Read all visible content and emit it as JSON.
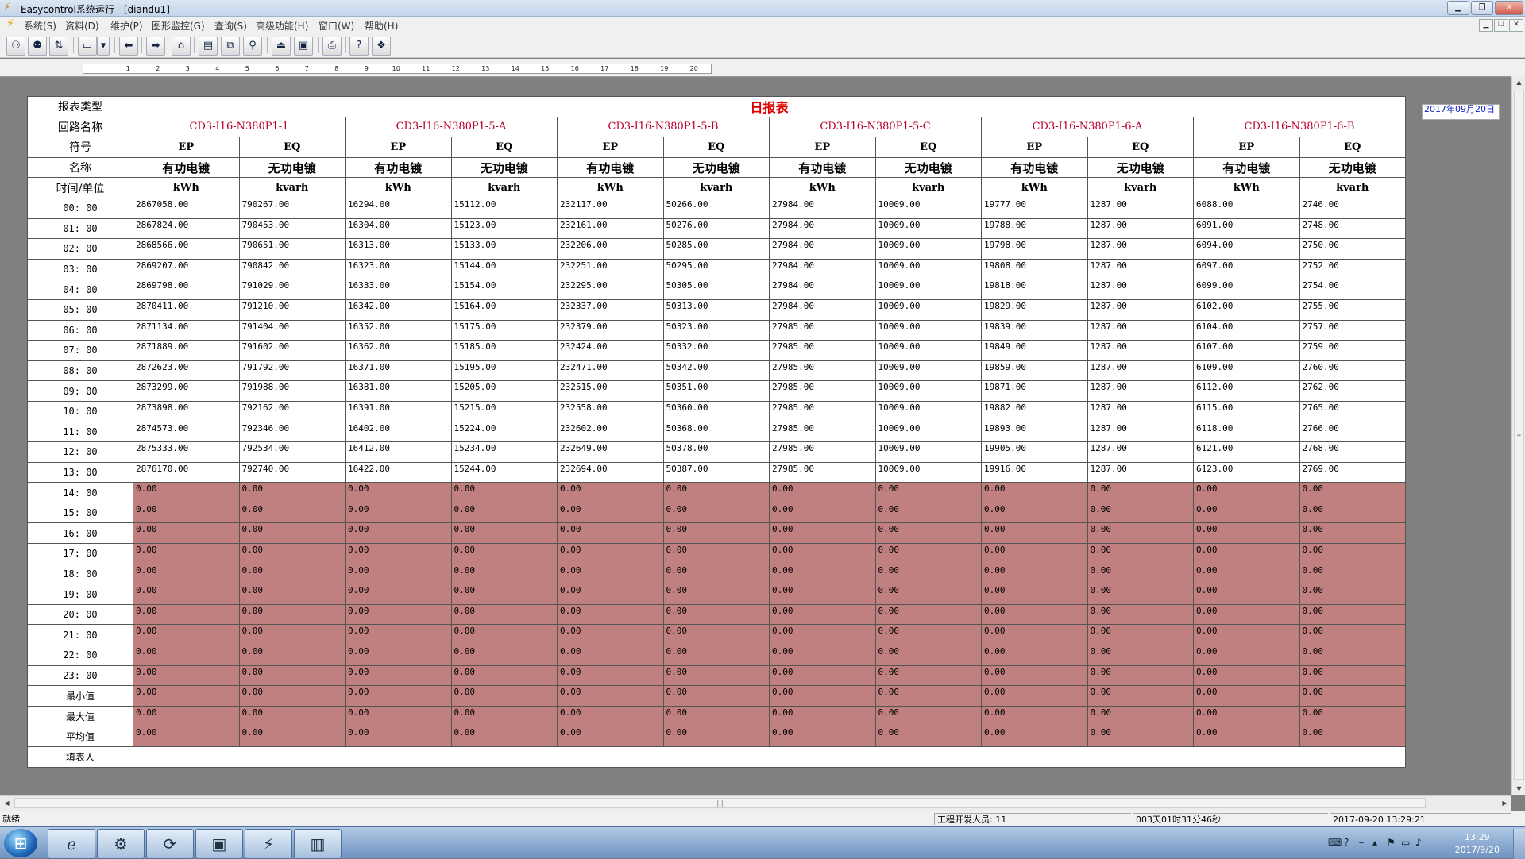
{
  "window": {
    "title": "Easycontrol系统运行 - [diandu1]",
    "minimize_icon": "minimize-icon",
    "restore_icon": "restore-icon",
    "close_icon": "close-icon"
  },
  "menu": [
    "系统(S)",
    "资料(D)",
    "维护(P)",
    "图形监控(G)",
    "查询(S)",
    "高级功能(H)",
    "窗口(W)",
    "帮助(H)"
  ],
  "ruler": {
    "labels": [
      " ",
      "1",
      "2",
      "3",
      "4",
      "5",
      "6",
      "7",
      "8",
      "9",
      "10",
      "11",
      "12",
      "13",
      "14",
      "15",
      "16",
      "17",
      "18",
      "19",
      "20"
    ]
  },
  "report": {
    "type_label": "报表类型",
    "title": "日报表",
    "circuit_label": "回路名称",
    "symbol_label": "符号",
    "name_label": "名称",
    "time_unit_label": "时间/单位",
    "filler_label": "填表人",
    "circuits": [
      "CD3-I16-N380P1-1",
      "CD3-I16-N380P1-5-A",
      "CD3-I16-N380P1-5-B",
      "CD3-I16-N380P1-5-C",
      "CD3-I16-N380P1-6-A",
      "CD3-I16-N380P1-6-B"
    ],
    "symbols": [
      "EP",
      "EQ",
      "EP",
      "EQ",
      "EP",
      "EQ",
      "EP",
      "EQ",
      "EP",
      "EQ",
      "EP",
      "EQ"
    ],
    "names": [
      "有功电镀",
      "无功电镀",
      "有功电镀",
      "无功电镀",
      "有功电镀",
      "无功电镀",
      "有功电镀",
      "无功电镀",
      "有功电镀",
      "无功电镀",
      "有功电镀",
      "无功电镀"
    ],
    "units": [
      "kWh",
      "kvarh",
      "kWh",
      "kvarh",
      "kWh",
      "kvarh",
      "kWh",
      "kvarh",
      "kWh",
      "kvarh",
      "kWh",
      "kvarh"
    ],
    "date": "2017年09月20日",
    "rows": [
      {
        "time": "00: 00",
        "values": [
          "2867058.00",
          "790267.00",
          "16294.00",
          "15112.00",
          "232117.00",
          "50266.00",
          "27984.00",
          "10009.00",
          "19777.00",
          "1287.00",
          "6088.00",
          "2746.00"
        ]
      },
      {
        "time": "01: 00",
        "values": [
          "2867824.00",
          "790453.00",
          "16304.00",
          "15123.00",
          "232161.00",
          "50276.00",
          "27984.00",
          "10009.00",
          "19788.00",
          "1287.00",
          "6091.00",
          "2748.00"
        ]
      },
      {
        "time": "02: 00",
        "values": [
          "2868566.00",
          "790651.00",
          "16313.00",
          "15133.00",
          "232206.00",
          "50285.00",
          "27984.00",
          "10009.00",
          "19798.00",
          "1287.00",
          "6094.00",
          "2750.00"
        ]
      },
      {
        "time": "03: 00",
        "values": [
          "2869207.00",
          "790842.00",
          "16323.00",
          "15144.00",
          "232251.00",
          "50295.00",
          "27984.00",
          "10009.00",
          "19808.00",
          "1287.00",
          "6097.00",
          "2752.00"
        ]
      },
      {
        "time": "04: 00",
        "values": [
          "2869798.00",
          "791029.00",
          "16333.00",
          "15154.00",
          "232295.00",
          "50305.00",
          "27984.00",
          "10009.00",
          "19818.00",
          "1287.00",
          "6099.00",
          "2754.00"
        ]
      },
      {
        "time": "05: 00",
        "values": [
          "2870411.00",
          "791210.00",
          "16342.00",
          "15164.00",
          "232337.00",
          "50313.00",
          "27984.00",
          "10009.00",
          "19829.00",
          "1287.00",
          "6102.00",
          "2755.00"
        ]
      },
      {
        "time": "06: 00",
        "values": [
          "2871134.00",
          "791404.00",
          "16352.00",
          "15175.00",
          "232379.00",
          "50323.00",
          "27985.00",
          "10009.00",
          "19839.00",
          "1287.00",
          "6104.00",
          "2757.00"
        ]
      },
      {
        "time": "07: 00",
        "values": [
          "2871889.00",
          "791602.00",
          "16362.00",
          "15185.00",
          "232424.00",
          "50332.00",
          "27985.00",
          "10009.00",
          "19849.00",
          "1287.00",
          "6107.00",
          "2759.00"
        ]
      },
      {
        "time": "08: 00",
        "values": [
          "2872623.00",
          "791792.00",
          "16371.00",
          "15195.00",
          "232471.00",
          "50342.00",
          "27985.00",
          "10009.00",
          "19859.00",
          "1287.00",
          "6109.00",
          "2760.00"
        ]
      },
      {
        "time": "09: 00",
        "values": [
          "2873299.00",
          "791988.00",
          "16381.00",
          "15205.00",
          "232515.00",
          "50351.00",
          "27985.00",
          "10009.00",
          "19871.00",
          "1287.00",
          "6112.00",
          "2762.00"
        ]
      },
      {
        "time": "10: 00",
        "values": [
          "2873898.00",
          "792162.00",
          "16391.00",
          "15215.00",
          "232558.00",
          "50360.00",
          "27985.00",
          "10009.00",
          "19882.00",
          "1287.00",
          "6115.00",
          "2765.00"
        ]
      },
      {
        "time": "11: 00",
        "values": [
          "2874573.00",
          "792346.00",
          "16402.00",
          "15224.00",
          "232602.00",
          "50368.00",
          "27985.00",
          "10009.00",
          "19893.00",
          "1287.00",
          "6118.00",
          "2766.00"
        ]
      },
      {
        "time": "12: 00",
        "values": [
          "2875333.00",
          "792534.00",
          "16412.00",
          "15234.00",
          "232649.00",
          "50378.00",
          "27985.00",
          "10009.00",
          "19905.00",
          "1287.00",
          "6121.00",
          "2768.00"
        ]
      },
      {
        "time": "13: 00",
        "values": [
          "2876170.00",
          "792740.00",
          "16422.00",
          "15244.00",
          "232694.00",
          "50387.00",
          "27985.00",
          "10009.00",
          "19916.00",
          "1287.00",
          "6123.00",
          "2769.00"
        ]
      },
      {
        "time": "14: 00",
        "values": [
          "0.00",
          "0.00",
          "0.00",
          "0.00",
          "0.00",
          "0.00",
          "0.00",
          "0.00",
          "0.00",
          "0.00",
          "0.00",
          "0.00"
        ],
        "empty": true
      },
      {
        "time": "15: 00",
        "values": [
          "0.00",
          "0.00",
          "0.00",
          "0.00",
          "0.00",
          "0.00",
          "0.00",
          "0.00",
          "0.00",
          "0.00",
          "0.00",
          "0.00"
        ],
        "empty": true
      },
      {
        "time": "16: 00",
        "values": [
          "0.00",
          "0.00",
          "0.00",
          "0.00",
          "0.00",
          "0.00",
          "0.00",
          "0.00",
          "0.00",
          "0.00",
          "0.00",
          "0.00"
        ],
        "empty": true
      },
      {
        "time": "17: 00",
        "values": [
          "0.00",
          "0.00",
          "0.00",
          "0.00",
          "0.00",
          "0.00",
          "0.00",
          "0.00",
          "0.00",
          "0.00",
          "0.00",
          "0.00"
        ],
        "empty": true
      },
      {
        "time": "18: 00",
        "values": [
          "0.00",
          "0.00",
          "0.00",
          "0.00",
          "0.00",
          "0.00",
          "0.00",
          "0.00",
          "0.00",
          "0.00",
          "0.00",
          "0.00"
        ],
        "empty": true
      },
      {
        "time": "19: 00",
        "values": [
          "0.00",
          "0.00",
          "0.00",
          "0.00",
          "0.00",
          "0.00",
          "0.00",
          "0.00",
          "0.00",
          "0.00",
          "0.00",
          "0.00"
        ],
        "empty": true
      },
      {
        "time": "20: 00",
        "values": [
          "0.00",
          "0.00",
          "0.00",
          "0.00",
          "0.00",
          "0.00",
          "0.00",
          "0.00",
          "0.00",
          "0.00",
          "0.00",
          "0.00"
        ],
        "empty": true
      },
      {
        "time": "21: 00",
        "values": [
          "0.00",
          "0.00",
          "0.00",
          "0.00",
          "0.00",
          "0.00",
          "0.00",
          "0.00",
          "0.00",
          "0.00",
          "0.00",
          "0.00"
        ],
        "empty": true
      },
      {
        "time": "22: 00",
        "values": [
          "0.00",
          "0.00",
          "0.00",
          "0.00",
          "0.00",
          "0.00",
          "0.00",
          "0.00",
          "0.00",
          "0.00",
          "0.00",
          "0.00"
        ],
        "empty": true
      },
      {
        "time": "23: 00",
        "values": [
          "0.00",
          "0.00",
          "0.00",
          "0.00",
          "0.00",
          "0.00",
          "0.00",
          "0.00",
          "0.00",
          "0.00",
          "0.00",
          "0.00"
        ],
        "empty": true
      }
    ],
    "stats": [
      {
        "label": "最小值",
        "values": [
          "0.00",
          "0.00",
          "0.00",
          "0.00",
          "0.00",
          "0.00",
          "0.00",
          "0.00",
          "0.00",
          "0.00",
          "0.00",
          "0.00"
        ]
      },
      {
        "label": "最大值",
        "values": [
          "0.00",
          "0.00",
          "0.00",
          "0.00",
          "0.00",
          "0.00",
          "0.00",
          "0.00",
          "0.00",
          "0.00",
          "0.00",
          "0.00"
        ]
      },
      {
        "label": "平均值",
        "values": [
          "0.00",
          "0.00",
          "0.00",
          "0.00",
          "0.00",
          "0.00",
          "0.00",
          "0.00",
          "0.00",
          "0.00",
          "0.00",
          "0.00"
        ]
      }
    ],
    "empty_cell_color": "#c08080"
  },
  "status": {
    "ready": "就绪",
    "developer": "工程开发人员: 11",
    "uptime": "003天01时31分46秒",
    "datetime": "2017-09-20 13:29:21"
  },
  "taskbar": {
    "time": "13:29",
    "date": "2017/9/20"
  },
  "colors": {
    "title_red": "#e00000",
    "circuit_red": "#b8002a",
    "date_blue": "#1020c8"
  }
}
